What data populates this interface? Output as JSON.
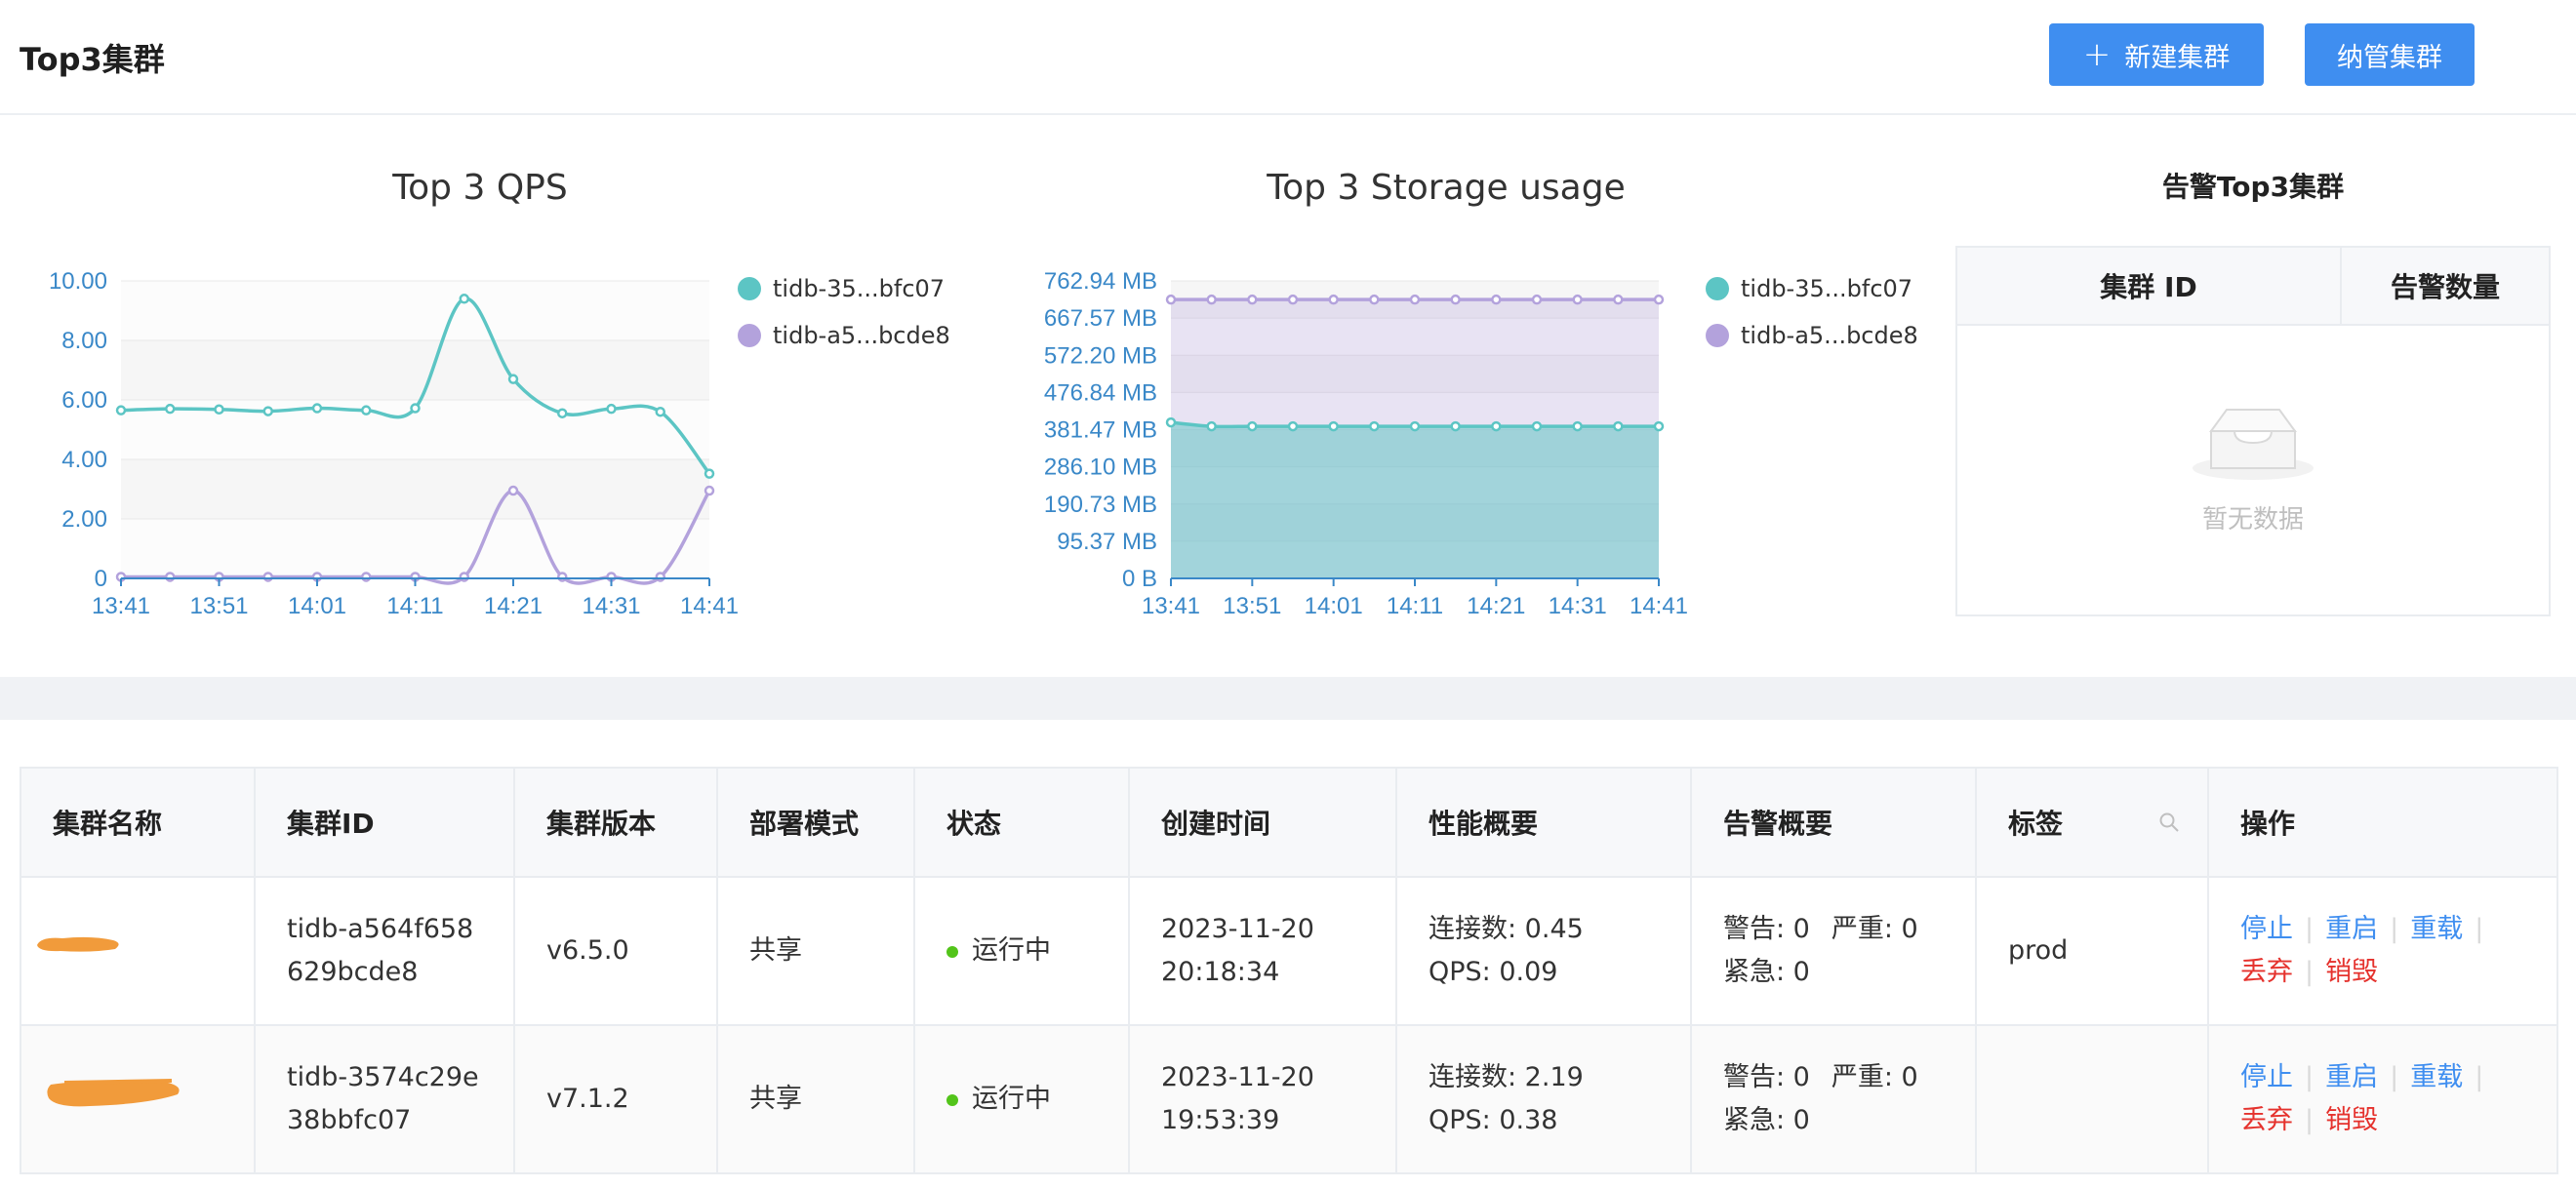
{
  "header": {
    "title": "Top3集群",
    "new_button": "新建集群",
    "manage_button": "纳管集群"
  },
  "colors": {
    "accent": "#3f8ef0",
    "series_a": "#5cc5c4",
    "series_b": "#b3a2dc",
    "danger": "#e5322d",
    "status_ok": "#52c41a"
  },
  "chart_data": [
    {
      "type": "line",
      "title": "Top 3 QPS",
      "x": [
        "13:41",
        "13:46",
        "13:51",
        "13:56",
        "14:01",
        "14:06",
        "14:11",
        "14:16",
        "14:21",
        "14:26",
        "14:31",
        "14:36",
        "14:41"
      ],
      "x_ticks": [
        "13:41",
        "13:51",
        "14:01",
        "14:11",
        "14:21",
        "14:31",
        "14:41"
      ],
      "y_ticks": [
        "0",
        "2.00",
        "4.00",
        "6.00",
        "8.00",
        "10.00"
      ],
      "ylim": [
        0,
        10
      ],
      "grid": true,
      "legend_position": "right",
      "series": [
        {
          "name": "tidb-35...bfc07",
          "values": [
            5.65,
            5.7,
            5.68,
            5.62,
            5.72,
            5.65,
            5.72,
            9.4,
            6.7,
            5.55,
            5.7,
            5.6,
            3.52
          ]
        },
        {
          "name": "tidb-a5...bcde8",
          "values": [
            0.05,
            0.05,
            0.05,
            0.05,
            0.05,
            0.05,
            0.05,
            0.05,
            2.95,
            0.05,
            0.05,
            0.05,
            2.95
          ]
        }
      ]
    },
    {
      "type": "area",
      "title": "Top 3 Storage usage",
      "x": [
        "13:41",
        "13:46",
        "13:51",
        "13:56",
        "14:01",
        "14:06",
        "14:11",
        "14:16",
        "14:21",
        "14:26",
        "14:31",
        "14:36",
        "14:41"
      ],
      "x_ticks": [
        "13:41",
        "13:51",
        "14:01",
        "14:11",
        "14:21",
        "14:31",
        "14:41"
      ],
      "y_ticks": [
        "0 B",
        "95.37 MB",
        "190.73 MB",
        "286.10 MB",
        "381.47 MB",
        "476.84 MB",
        "572.20 MB",
        "667.57 MB",
        "762.94 MB"
      ],
      "ylim": [
        0,
        762.94
      ],
      "y_unit": "MB",
      "grid": true,
      "legend_position": "right",
      "series": [
        {
          "name": "tidb-35...bfc07",
          "values": [
            400,
            390,
            390,
            390,
            390,
            390,
            390,
            390,
            390,
            390,
            390,
            390,
            390
          ]
        },
        {
          "name": "tidb-a5...bcde8",
          "values": [
            715,
            715,
            715,
            715,
            715,
            715,
            715,
            715,
            715,
            715,
            715,
            715,
            715
          ]
        }
      ]
    }
  ],
  "alerts": {
    "title": "告警Top3集群",
    "col_id": "集群 ID",
    "col_count": "告警数量",
    "empty_text": "暂无数据"
  },
  "table": {
    "headers": [
      "集群名称",
      "集群ID",
      "集群版本",
      "部署模式",
      "状态",
      "创建时间",
      "性能概要",
      "告警概要",
      "标签",
      "操作"
    ],
    "rows": [
      {
        "id_line1": "tidb-a564f658",
        "id_line2": "629bcde8",
        "version": "v6.5.0",
        "mode": "共享",
        "status": "运行中",
        "created_date": "2023-11-20",
        "created_time": "20:18:34",
        "perf_conn": "连接数: 0.45",
        "perf_qps": "QPS: 0.09",
        "alert_warn": "警告: 0",
        "alert_severe": "严重: 0",
        "alert_urgent": "紧急: 0",
        "tag": "prod"
      },
      {
        "id_line1": "tidb-3574c29e",
        "id_line2": "38bbfc07",
        "version": "v7.1.2",
        "mode": "共享",
        "status": "运行中",
        "created_date": "2023-11-20",
        "created_time": "19:53:39",
        "perf_conn": "连接数: 2.19",
        "perf_qps": "QPS: 0.38",
        "alert_warn": "警告: 0",
        "alert_severe": "严重: 0",
        "alert_urgent": "紧急: 0",
        "tag": ""
      }
    ],
    "actions": {
      "stop": "停止",
      "restart": "重启",
      "reload": "重载",
      "abandon": "丢弃",
      "destroy": "销毁"
    }
  }
}
